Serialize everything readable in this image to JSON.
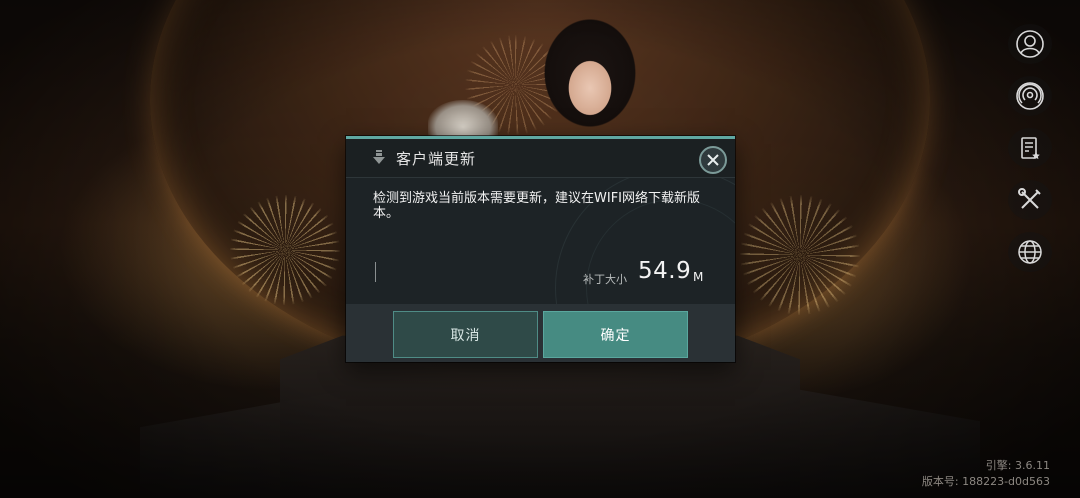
{
  "dialog": {
    "title": "客户端更新",
    "message": "检测到游戏当前版本需要更新，建议在WIFI网络下载新版本。",
    "patch_label": "补丁大小",
    "patch_size": "54.9",
    "patch_unit": "M",
    "cancel_label": "取消",
    "confirm_label": "确定",
    "icons": {
      "header": "download-icon",
      "close": "close-icon"
    }
  },
  "side_menu": {
    "items": [
      {
        "icon": "user-account-icon"
      },
      {
        "icon": "broadcast-icon"
      },
      {
        "icon": "notice-icon"
      },
      {
        "icon": "tools-icon"
      },
      {
        "icon": "globe-icon"
      }
    ]
  },
  "version_info": {
    "engine": "引擎: 3.6.11",
    "version": "版本号: 188223-d0d563"
  },
  "colors": {
    "accent": "#5fa8a2",
    "confirm_button": "#468b82",
    "cancel_button": "#2f4a48"
  }
}
